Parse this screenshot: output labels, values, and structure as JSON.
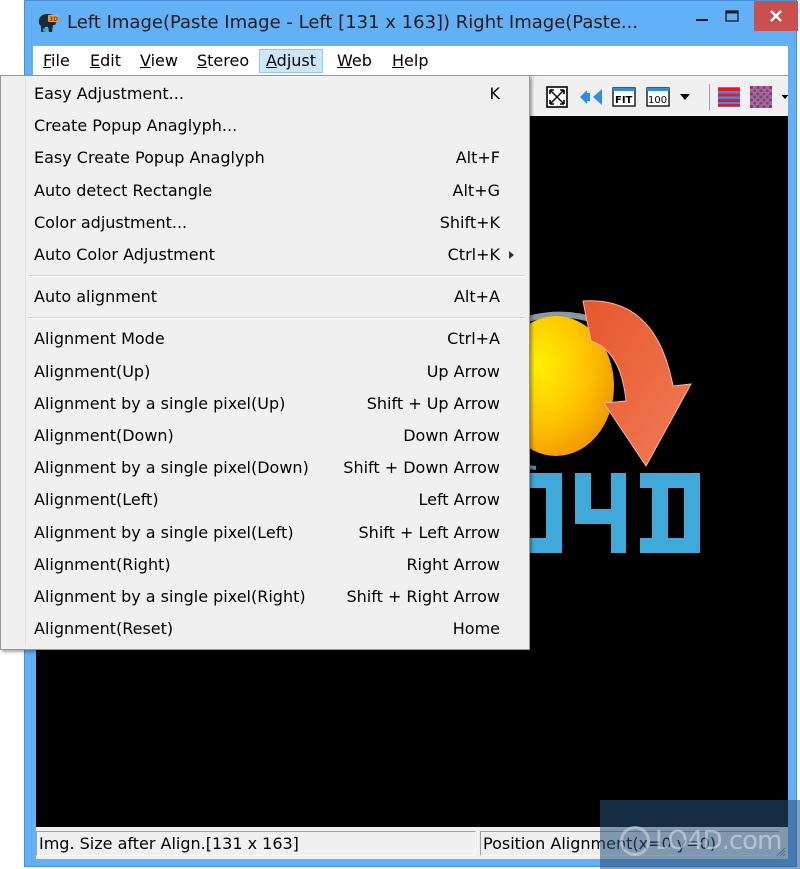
{
  "window": {
    "title": "Left Image(Paste Image - Left [131 x 163]) Right Image(Paste...",
    "controls": {
      "minimize": "minimize",
      "maximize": "maximize",
      "close": "close"
    }
  },
  "menubar": {
    "items": [
      {
        "label": "File",
        "mnemonic": "F",
        "rest": "ile"
      },
      {
        "label": "Edit",
        "mnemonic": "E",
        "rest": "dit"
      },
      {
        "label": "View",
        "mnemonic": "V",
        "rest": "iew"
      },
      {
        "label": "Stereo",
        "mnemonic": "S",
        "rest": "tereo"
      },
      {
        "label": "Adjust",
        "mnemonic": "A",
        "rest": "djust",
        "active": true
      },
      {
        "label": "Web",
        "mnemonic": "W",
        "rest": "eb"
      },
      {
        "label": "Help",
        "mnemonic": "H",
        "rest": "elp"
      }
    ]
  },
  "toolbar": {
    "icons": [
      "fullscreen-icon",
      "swap-left-right-icon",
      "fit-icon",
      "zoom-100-icon",
      "zoom-dropdown-icon",
      "interlace-lines-icon",
      "checkerboard-icon",
      "display-mode-dropdown-icon"
    ],
    "fit_label": "FIT",
    "zoom_label": "100"
  },
  "adjust_menu": {
    "groups": [
      [
        {
          "label": "Easy Adjustment...",
          "shortcut": "K"
        },
        {
          "label": "Create Popup Anaglyph...",
          "shortcut": ""
        },
        {
          "label": "Easy Create Popup Anaglyph",
          "shortcut": "Alt+F"
        },
        {
          "label": "Auto detect Rectangle",
          "shortcut": "Alt+G"
        },
        {
          "label": "Color adjustment...",
          "shortcut": "Shift+K"
        },
        {
          "label": "Auto Color Adjustment",
          "shortcut": "Ctrl+K",
          "submenu": true
        }
      ],
      [
        {
          "label": "Auto alignment",
          "shortcut": "Alt+A"
        }
      ],
      [
        {
          "label": "Alignment Mode",
          "shortcut": "Ctrl+A"
        },
        {
          "label": "Alignment(Up)",
          "shortcut": "Up Arrow"
        },
        {
          "label": "Alignment by a single pixel(Up)",
          "shortcut": "Shift + Up Arrow"
        },
        {
          "label": "Alignment(Down)",
          "shortcut": "Down Arrow"
        },
        {
          "label": "Alignment by a single pixel(Down)",
          "shortcut": "Shift + Down Arrow"
        },
        {
          "label": "Alignment(Left)",
          "shortcut": "Left Arrow"
        },
        {
          "label": "Alignment by a single pixel(Left)",
          "shortcut": "Shift + Left Arrow"
        },
        {
          "label": "Alignment(Right)",
          "shortcut": "Right Arrow"
        },
        {
          "label": "Alignment by a single pixel(Right)",
          "shortcut": "Shift + Right Arrow"
        },
        {
          "label": "Alignment(Reset)",
          "shortcut": "Home"
        }
      ]
    ]
  },
  "canvas": {
    "logo_text": "04D",
    "background": "#000000"
  },
  "statusbar": {
    "image_size": "Img. Size after Align.[131 x 163]",
    "position_alignment": "Position Alignment(x=0 y=0)"
  },
  "watermark": {
    "text": "LO4D.com"
  },
  "colors": {
    "frame": "#62b0f5",
    "close": "#c9504f",
    "menu_active": "#cde6fb",
    "logo_blue": "#3fa9d9",
    "arrow_orange": "#ee6a3c",
    "sun_yellow": "#ffd200"
  }
}
